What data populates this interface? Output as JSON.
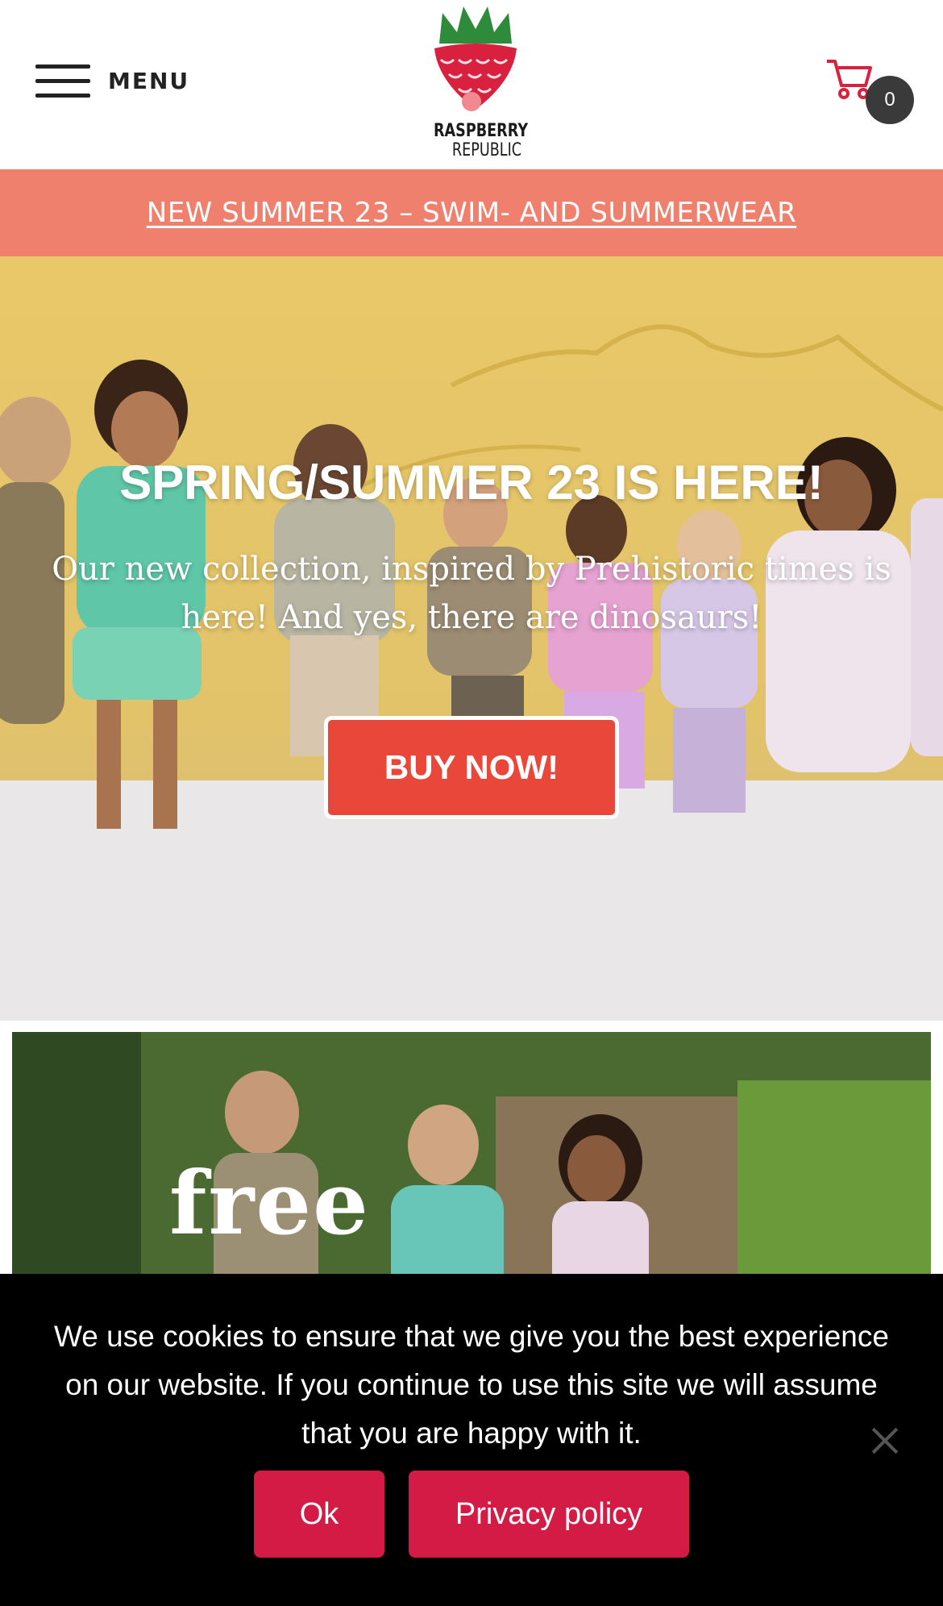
{
  "header": {
    "menu_label": "MENU",
    "logo_line1": "RASPBERRY",
    "logo_line2": "REPUBLIC",
    "cart_count": "0"
  },
  "promo": {
    "link_text": "NEW SUMMER 23 – SWIM- AND SUMMERWEAR"
  },
  "hero": {
    "title": "SPRING/SUMMER 23 IS HERE!",
    "subtitle": "Our new collection, inspired by Prehistoric times is here! And yes, there are dinosaurs!",
    "button_label": "BUY NOW!"
  },
  "banner2": {
    "word": "free"
  },
  "cookie": {
    "message": "We use cookies to ensure that we give you the best experience on our website. If you continue to use this site we will assume that you are happy with it.",
    "ok_label": "Ok",
    "privacy_label": "Privacy policy"
  },
  "colors": {
    "promo_bg": "#f0806e",
    "hero_button": "#e8473a",
    "cookie_button": "#d41b45",
    "brand_red": "#d9213f",
    "brand_green": "#2e8b3c"
  }
}
